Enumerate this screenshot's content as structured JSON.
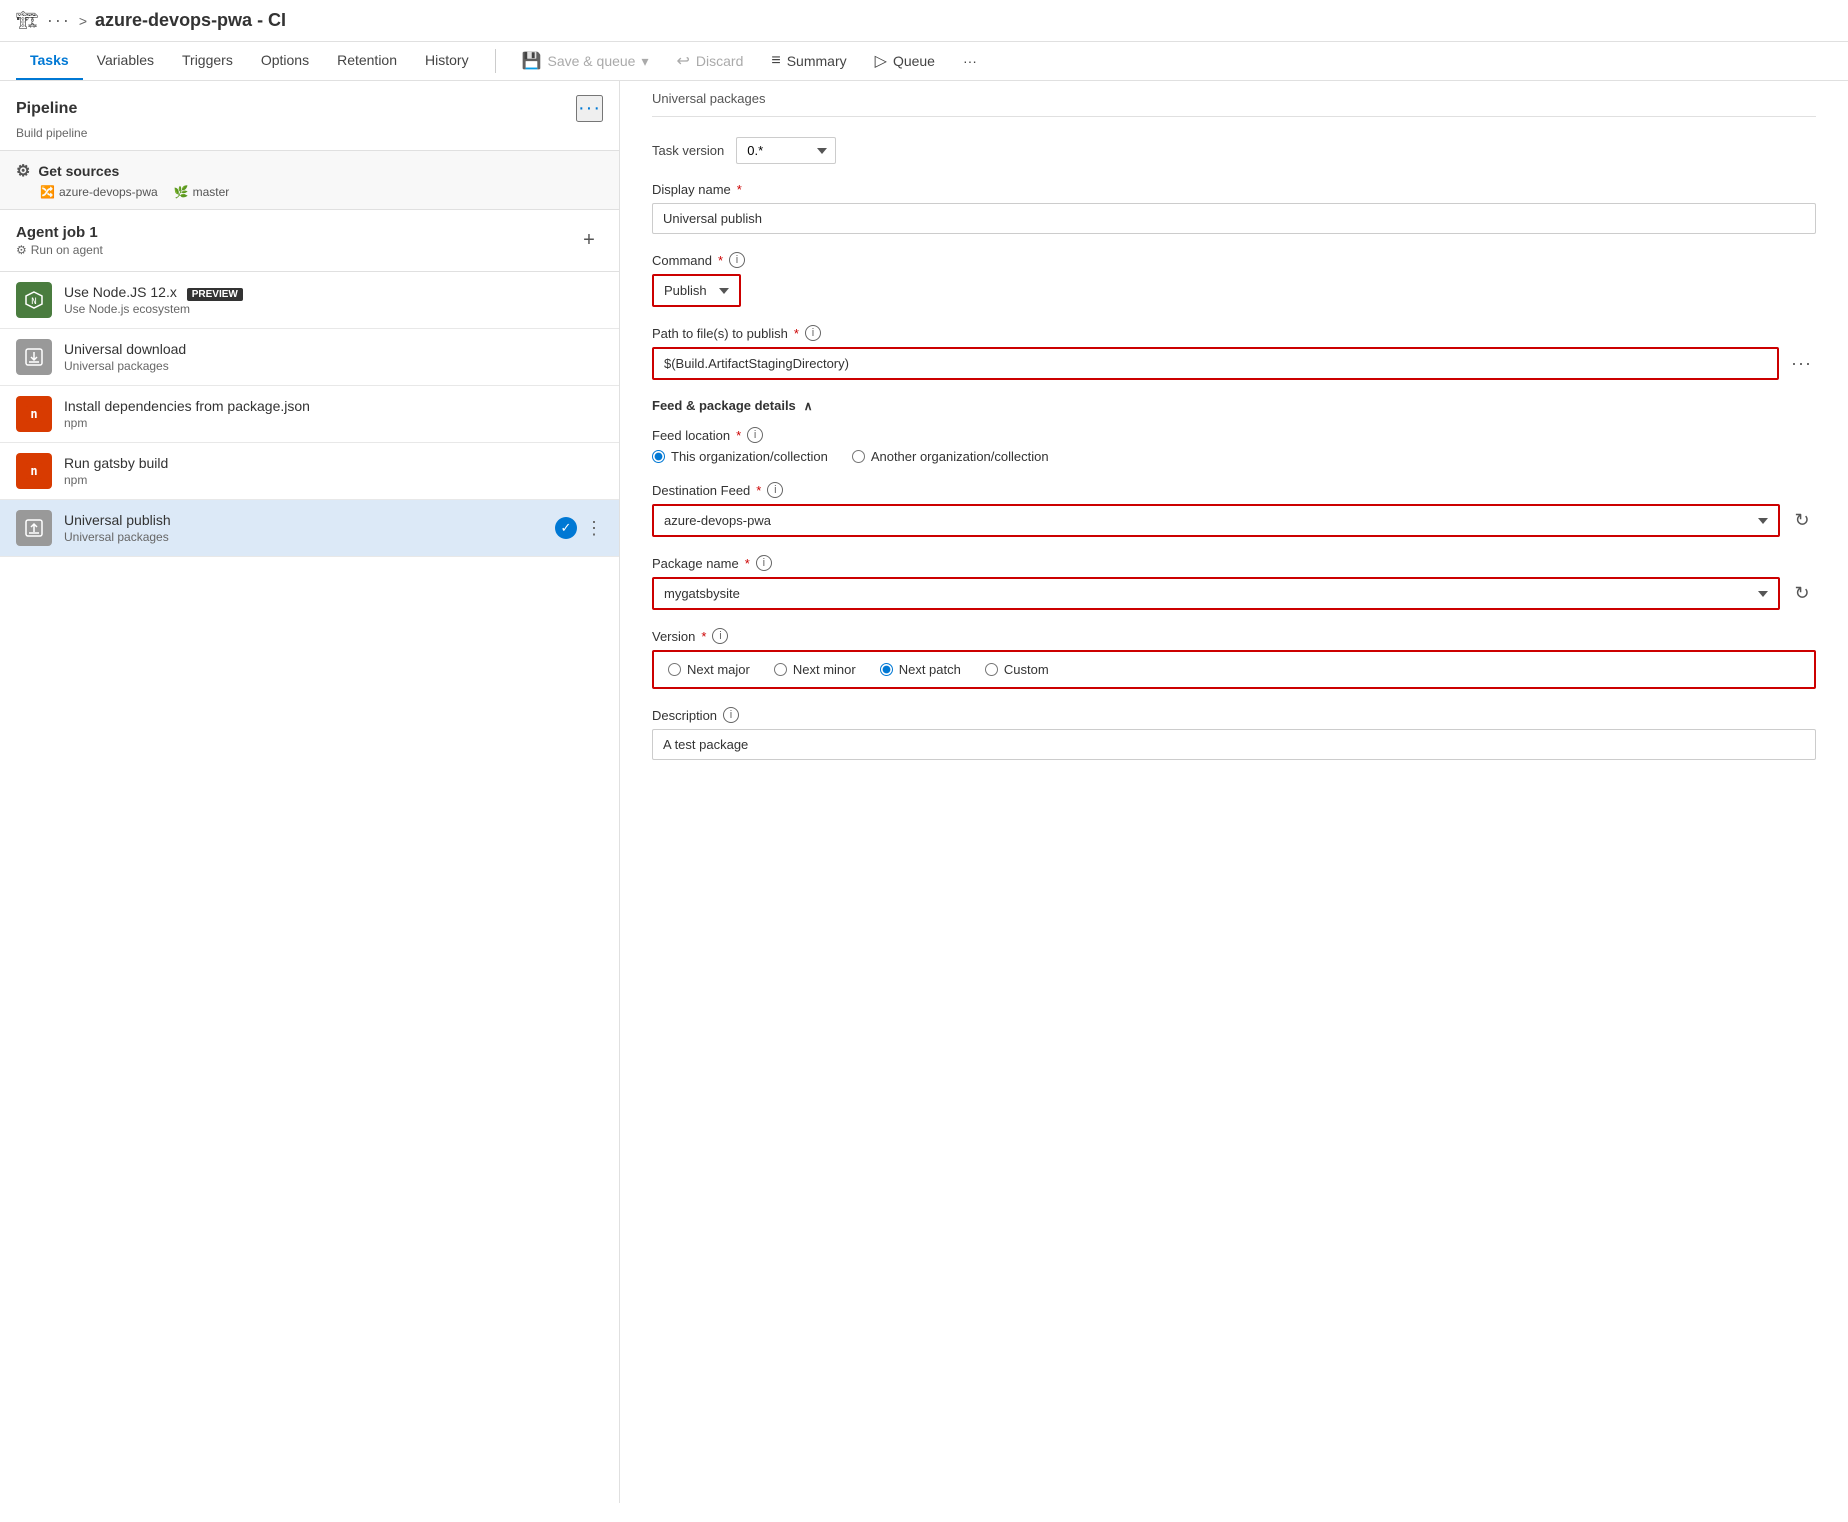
{
  "topbar": {
    "icon": "🏗",
    "dots": "···",
    "chevron": ">",
    "title": "azure-devops-pwa - CI"
  },
  "nav": {
    "tabs": [
      {
        "label": "Tasks",
        "active": true
      },
      {
        "label": "Variables",
        "active": false
      },
      {
        "label": "Triggers",
        "active": false
      },
      {
        "label": "Options",
        "active": false
      },
      {
        "label": "Retention",
        "active": false
      },
      {
        "label": "History",
        "active": false
      }
    ],
    "actions": [
      {
        "label": "Save & queue",
        "icon": "💾",
        "hasDropdown": true,
        "disabled": false
      },
      {
        "label": "Discard",
        "icon": "↩",
        "disabled": false
      },
      {
        "label": "Summary",
        "icon": "≡",
        "disabled": false
      },
      {
        "label": "Queue",
        "icon": "▷",
        "disabled": false
      },
      {
        "label": "···",
        "icon": "",
        "disabled": false
      }
    ]
  },
  "leftPanel": {
    "pipeline": {
      "title": "Pipeline",
      "sub": "Build pipeline",
      "dots": "···"
    },
    "getSources": {
      "title": "Get sources",
      "repo": "azure-devops-pwa",
      "branch": "master"
    },
    "agentJob": {
      "title": "Agent job 1",
      "sub": "Run on agent"
    },
    "tasks": [
      {
        "id": "nodejs",
        "name": "Use Node.JS 12.x",
        "preview": "PREVIEW",
        "sub": "Use Node.js ecosystem",
        "iconColor": "green",
        "iconChar": "⬡",
        "selected": false
      },
      {
        "id": "universal-download",
        "name": "Universal download",
        "sub": "Universal packages",
        "iconColor": "gray",
        "iconChar": "⬇",
        "selected": false
      },
      {
        "id": "install-deps",
        "name": "Install dependencies from package.json",
        "sub": "npm",
        "iconColor": "red",
        "iconChar": "n",
        "selected": false
      },
      {
        "id": "run-gatsby",
        "name": "Run gatsby build",
        "sub": "npm",
        "iconColor": "red",
        "iconChar": "n",
        "selected": false
      },
      {
        "id": "universal-publish",
        "name": "Universal publish",
        "sub": "Universal packages",
        "iconColor": "gray",
        "iconChar": "⬆",
        "selected": true,
        "hasCheck": true
      }
    ]
  },
  "rightPanel": {
    "topText": "Universal packages",
    "taskVersionLabel": "Task version",
    "taskVersionValue": "0.*",
    "displayNameLabel": "Display name",
    "displayNameRequired": "*",
    "displayNameValue": "Universal publish",
    "commandLabel": "Command",
    "commandRequired": "*",
    "commandValue": "Publish",
    "pathLabel": "Path to file(s) to publish",
    "pathRequired": "*",
    "pathValue": "$(Build.ArtifactStagingDirectory)",
    "feedSection": "Feed & package details",
    "feedLocationLabel": "Feed location",
    "feedLocationRequired": "*",
    "feedOptions": [
      {
        "label": "This organization/collection",
        "checked": true
      },
      {
        "label": "Another organization/collection",
        "checked": false
      }
    ],
    "destinationFeedLabel": "Destination Feed",
    "destinationFeedRequired": "*",
    "destinationFeedValue": "azure-devops-pwa",
    "packageNameLabel": "Package name",
    "packageNameRequired": "*",
    "packageNameValue": "mygatsbysite",
    "versionLabel": "Version",
    "versionRequired": "*",
    "versionOptions": [
      {
        "label": "Next major",
        "value": "next-major",
        "checked": false
      },
      {
        "label": "Next minor",
        "value": "next-minor",
        "checked": false
      },
      {
        "label": "Next patch",
        "value": "next-patch",
        "checked": true
      },
      {
        "label": "Custom",
        "value": "custom",
        "checked": false
      }
    ],
    "descriptionLabel": "Description",
    "descriptionValue": "A test package"
  }
}
